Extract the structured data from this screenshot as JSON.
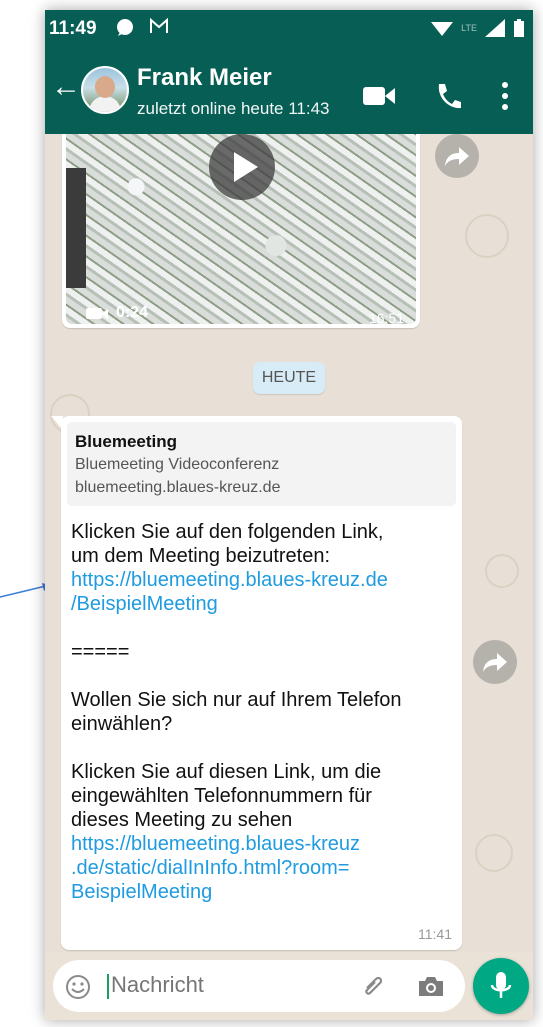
{
  "status_bar": {
    "time": "11:49",
    "network": "LTE"
  },
  "header": {
    "contact_name": "Frank Meier",
    "last_seen": "zuletzt online heute 11:43"
  },
  "video_message": {
    "duration": "0:24",
    "time": "16:51"
  },
  "date_divider": "HEUTE",
  "link_preview": {
    "title": "Bluemeeting",
    "description": "Bluemeeting Videoconferenz",
    "domain": "bluemeeting.blaues-kreuz.de"
  },
  "message": {
    "intro_1": "Klicken Sie auf den folgenden Link,",
    "intro_2": "um dem Meeting beizutreten:",
    "link1_a": "https://bluemeeting.blaues-kreuz.de",
    "link1_b": "/BeispielMeeting",
    "separator": "=====",
    "phone_q1": "Wollen Sie sich nur auf Ihrem Telefon",
    "phone_q2": "einwählen?",
    "dial_1": "Klicken Sie auf diesen Link, um die",
    "dial_2": "eingewählten Telefonnummern für",
    "dial_3": "dieses Meeting zu sehen",
    "link2_a": "https://bluemeeting.blaues-kreuz",
    "link2_b": ".de/static/dialInInfo.html?room=",
    "link2_c": "BeispielMeeting",
    "time": "11:41"
  },
  "composer": {
    "placeholder": "Nachricht"
  },
  "colors": {
    "header": "#075e54",
    "link": "#1e9be1",
    "mic": "#00a884",
    "date_chip": "#d7ecf6"
  }
}
